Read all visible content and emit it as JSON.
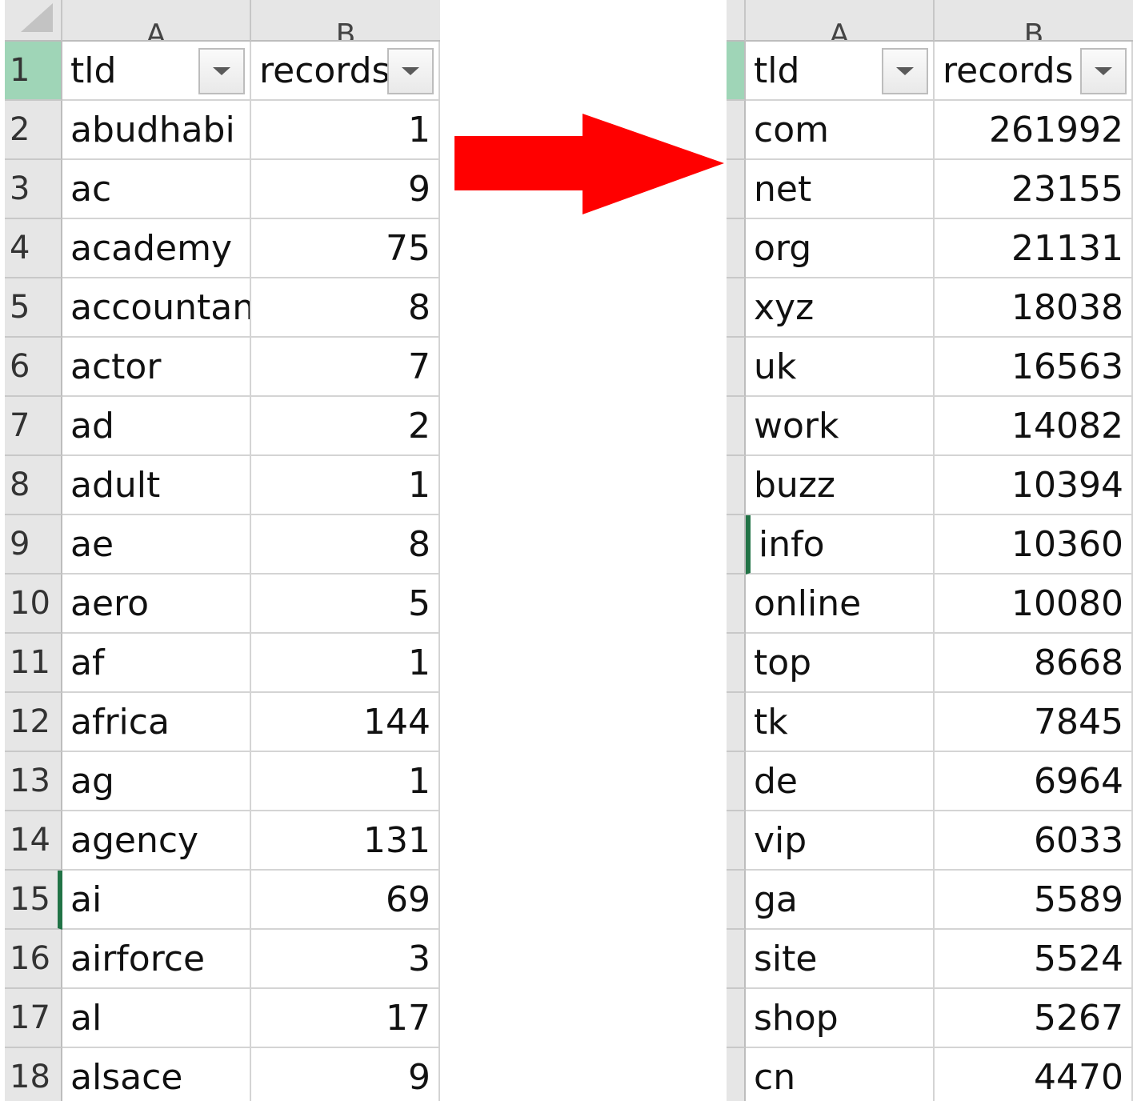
{
  "left_sheet": {
    "columns": {
      "a": "A",
      "b": "B"
    },
    "header": {
      "tld": "tld",
      "records": "records"
    },
    "row_numbers": [
      "1",
      "2",
      "3",
      "4",
      "5",
      "6",
      "7",
      "8",
      "9",
      "10",
      "11",
      "12",
      "13",
      "14",
      "15",
      "16",
      "17",
      "18"
    ],
    "rows": [
      {
        "tld": "abudhabi",
        "records": "1"
      },
      {
        "tld": "ac",
        "records": "9"
      },
      {
        "tld": "academy",
        "records": "75"
      },
      {
        "tld": "accountan",
        "records": "8"
      },
      {
        "tld": "actor",
        "records": "7"
      },
      {
        "tld": "ad",
        "records": "2"
      },
      {
        "tld": "adult",
        "records": "1"
      },
      {
        "tld": "ae",
        "records": "8"
      },
      {
        "tld": "aero",
        "records": "5"
      },
      {
        "tld": "af",
        "records": "1"
      },
      {
        "tld": "africa",
        "records": "144"
      },
      {
        "tld": "ag",
        "records": "1"
      },
      {
        "tld": "agency",
        "records": "131"
      },
      {
        "tld": "ai",
        "records": "69"
      },
      {
        "tld": "airforce",
        "records": "3"
      },
      {
        "tld": "al",
        "records": "17"
      },
      {
        "tld": "alsace",
        "records": "9"
      }
    ]
  },
  "right_sheet": {
    "columns": {
      "a": "A",
      "b": "B"
    },
    "header": {
      "tld": "tld",
      "records": "records"
    },
    "rows": [
      {
        "tld": "com",
        "records": "261992"
      },
      {
        "tld": "net",
        "records": "23155"
      },
      {
        "tld": "org",
        "records": "21131"
      },
      {
        "tld": "xyz",
        "records": "18038"
      },
      {
        "tld": "uk",
        "records": "16563"
      },
      {
        "tld": "work",
        "records": "14082"
      },
      {
        "tld": "buzz",
        "records": "10394"
      },
      {
        "tld": "info",
        "records": "10360"
      },
      {
        "tld": "online",
        "records": "10080"
      },
      {
        "tld": "top",
        "records": "8668"
      },
      {
        "tld": "tk",
        "records": "7845"
      },
      {
        "tld": "de",
        "records": "6964"
      },
      {
        "tld": "vip",
        "records": "6033"
      },
      {
        "tld": "ga",
        "records": "5589"
      },
      {
        "tld": "site",
        "records": "5524"
      },
      {
        "tld": "shop",
        "records": "5267"
      },
      {
        "tld": "cn",
        "records": "4470"
      }
    ]
  },
  "colors": {
    "arrow": "#ff0000",
    "selected_header": "#9fd5b7",
    "active_indicator": "#217346",
    "header_bg": "#e6e6e6"
  },
  "icons": {
    "arrow": "right-arrow-icon",
    "filter": "filter-dropdown-icon"
  }
}
